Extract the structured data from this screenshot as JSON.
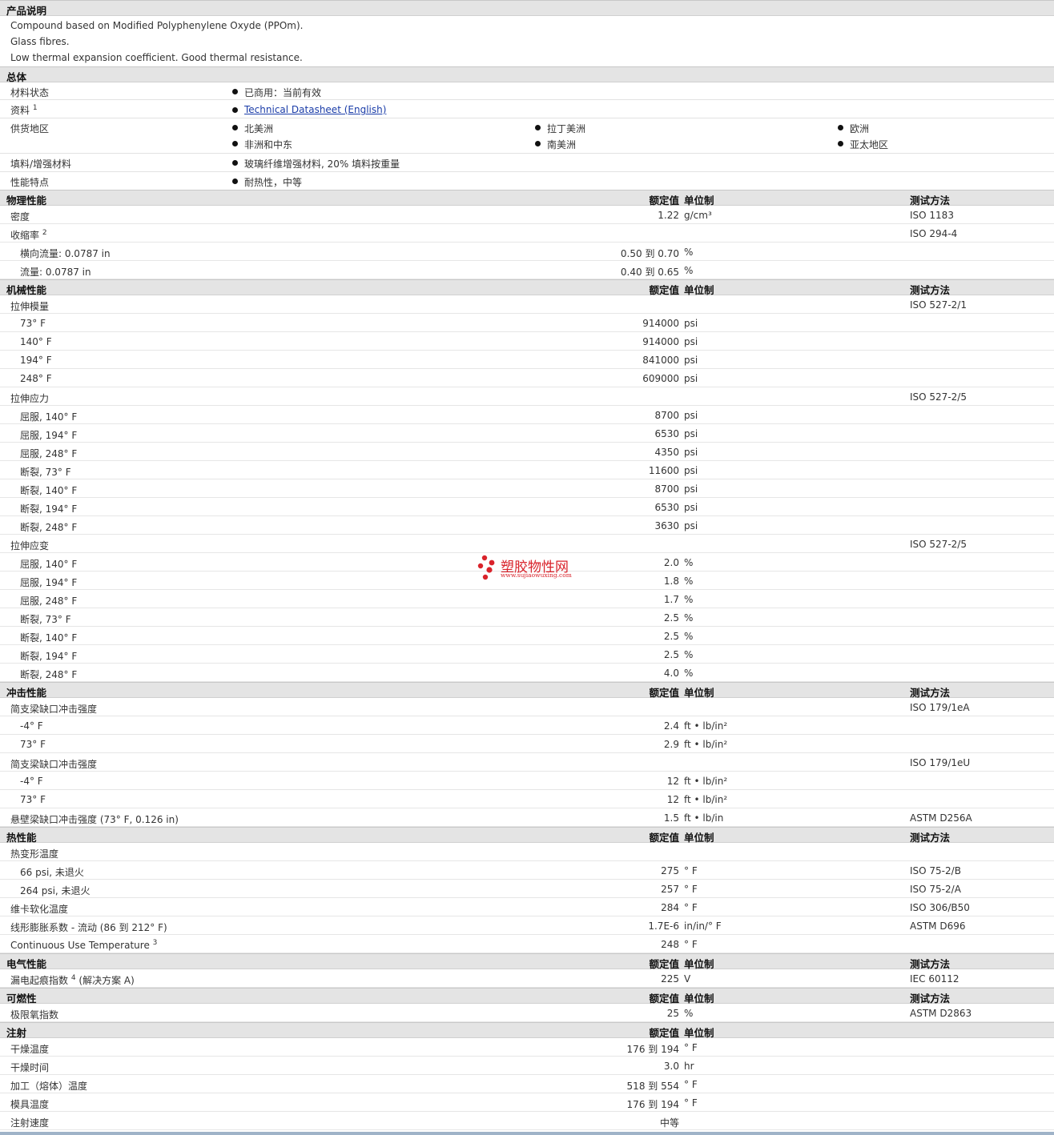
{
  "sections": {
    "description": {
      "title": "产品说明",
      "lines": [
        "Compound based on Modified Polyphenylene Oxyde (PPOm).",
        "Glass fibres.",
        "Low thermal expansion coefficient. Good thermal resistance."
      ]
    },
    "general": {
      "title": "总体",
      "status_label": "材料状态",
      "status_value": "已商用：当前有效",
      "docs_label": "资料",
      "docs_sup": "1",
      "docs_link": "Technical Datasheet (English)",
      "regions_label": "供货地区",
      "regions": [
        "北美洲",
        "拉丁美洲",
        "欧洲",
        "非洲和中东",
        "南美洲",
        "亚太地区"
      ],
      "filler_label": "填料/增强材料",
      "filler_value": "玻璃纤维增强材料, 20% 填料按重量",
      "features_label": "性能特点",
      "features_value": "耐热性，中等"
    },
    "physical": {
      "title": "物理性能",
      "h_val": "额定值",
      "h_unit": "单位制",
      "h_method": "测试方法"
    },
    "mechanical": {
      "title": "机械性能",
      "h_val": "额定值",
      "h_unit": "单位制",
      "h_method": "测试方法"
    },
    "impact": {
      "title": "冲击性能",
      "h_val": "额定值",
      "h_unit": "单位制",
      "h_method": "测试方法"
    },
    "thermal": {
      "title": "热性能",
      "h_val": "额定值",
      "h_unit": "单位制",
      "h_method": "测试方法"
    },
    "electrical": {
      "title": "电气性能",
      "h_val": "额定值",
      "h_unit": "单位制",
      "h_method": "测试方法"
    },
    "flammability": {
      "title": "可燃性",
      "h_val": "额定值",
      "h_unit": "单位制",
      "h_method": "测试方法"
    },
    "injection": {
      "title": "注射",
      "h_val": "额定值",
      "h_unit": "单位制"
    }
  },
  "rows": {
    "physical": [
      {
        "label": "密度",
        "value": "1.22",
        "unit": "g/cm³",
        "method": "ISO 1183"
      },
      {
        "label": "收缩率",
        "sup": "2",
        "value": "",
        "unit": "",
        "method": "ISO 294-4"
      },
      {
        "label": "横向流量: 0.0787 in",
        "value": "0.50 到  0.70",
        "unit": "%",
        "method": ""
      },
      {
        "label": "流量: 0.0787 in",
        "value": "0.40 到  0.65",
        "unit": "%",
        "method": ""
      }
    ],
    "mechanical": [
      {
        "label": "拉伸模量",
        "value": "",
        "unit": "",
        "method": "ISO 527-2/1"
      },
      {
        "label": "73°  F",
        "value": "914000",
        "unit": "psi",
        "method": ""
      },
      {
        "label": "140°  F",
        "value": "914000",
        "unit": "psi",
        "method": ""
      },
      {
        "label": "194°  F",
        "value": "841000",
        "unit": "psi",
        "method": ""
      },
      {
        "label": "248°  F",
        "value": "609000",
        "unit": "psi",
        "method": ""
      },
      {
        "label": "拉伸应力",
        "value": "",
        "unit": "",
        "method": "ISO 527-2/5"
      },
      {
        "label": "屈服, 140°  F",
        "value": "8700",
        "unit": "psi",
        "method": ""
      },
      {
        "label": "屈服, 194°  F",
        "value": "6530",
        "unit": "psi",
        "method": ""
      },
      {
        "label": "屈服, 248°  F",
        "value": "4350",
        "unit": "psi",
        "method": ""
      },
      {
        "label": "断裂, 73°  F",
        "value": "11600",
        "unit": "psi",
        "method": ""
      },
      {
        "label": "断裂, 140°  F",
        "value": "8700",
        "unit": "psi",
        "method": ""
      },
      {
        "label": "断裂, 194°  F",
        "value": "6530",
        "unit": "psi",
        "method": ""
      },
      {
        "label": "断裂, 248°  F",
        "value": "3630",
        "unit": "psi",
        "method": ""
      },
      {
        "label": "拉伸应变",
        "value": "",
        "unit": "",
        "method": "ISO 527-2/5"
      },
      {
        "label": "屈服, 140°  F",
        "value": "2.0",
        "unit": "%",
        "method": ""
      },
      {
        "label": "屈服, 194°  F",
        "value": "1.8",
        "unit": "%",
        "method": ""
      },
      {
        "label": "屈服, 248°  F",
        "value": "1.7",
        "unit": "%",
        "method": ""
      },
      {
        "label": "断裂, 73°  F",
        "value": "2.5",
        "unit": "%",
        "method": ""
      },
      {
        "label": "断裂, 140°  F",
        "value": "2.5",
        "unit": "%",
        "method": ""
      },
      {
        "label": "断裂, 194°  F",
        "value": "2.5",
        "unit": "%",
        "method": ""
      },
      {
        "label": "断裂, 248°  F",
        "value": "4.0",
        "unit": "%",
        "method": ""
      }
    ],
    "impact": [
      {
        "label": "简支梁缺口冲击强度",
        "value": "",
        "unit": "",
        "method": "ISO 179/1eA"
      },
      {
        "label": "-4°  F",
        "value": "2.4",
        "unit": "ft • lb/in²",
        "method": ""
      },
      {
        "label": "73°  F",
        "value": "2.9",
        "unit": "ft • lb/in²",
        "method": ""
      },
      {
        "label": "简支梁缺口冲击强度",
        "value": "",
        "unit": "",
        "method": "ISO 179/1eU"
      },
      {
        "label": "-4°  F",
        "value": "12",
        "unit": "ft • lb/in²",
        "method": ""
      },
      {
        "label": "73°  F",
        "value": "12",
        "unit": "ft • lb/in²",
        "method": ""
      },
      {
        "label": "悬壁梁缺口冲击强度  (73°  F, 0.126 in)",
        "value": "1.5",
        "unit": "ft • lb/in",
        "method": "ASTM D256A"
      }
    ],
    "thermal": [
      {
        "label": "热变形温度",
        "value": "",
        "unit": "",
        "method": ""
      },
      {
        "label": "66 psi, 未退火",
        "value": "275",
        "unit": "°  F",
        "method": "ISO 75-2/B"
      },
      {
        "label": "264 psi, 未退火",
        "value": "257",
        "unit": "°  F",
        "method": "ISO 75-2/A"
      },
      {
        "label": "维卡软化温度",
        "value": "284",
        "unit": "°  F",
        "method": "ISO 306/B50"
      },
      {
        "label": "线形膨胀系数  - 流动  (86 到  212°  F)",
        "value": "1.7E-6",
        "unit": "in/in/°  F",
        "method": "ASTM D696"
      },
      {
        "label": "Continuous Use Temperature",
        "sup": "3",
        "value": "248",
        "unit": "°  F",
        "method": ""
      }
    ],
    "electrical": [
      {
        "label": "漏电起痕指数",
        "sup": "4",
        "label_suffix": " (解决方案  A)",
        "value": "225",
        "unit": "V",
        "method": "IEC 60112"
      }
    ],
    "flammability": [
      {
        "label": "极限氧指数",
        "value": "25",
        "unit": "%",
        "method": "ASTM D2863"
      }
    ],
    "injection": [
      {
        "label": "干燥温度",
        "value": "176 到  194",
        "unit": "°  F",
        "method": ""
      },
      {
        "label": "干燥时间",
        "value": "3.0",
        "unit": "hr",
        "method": ""
      },
      {
        "label": "加工（熔体）温度",
        "value": "518 到  554",
        "unit": "°  F",
        "method": ""
      },
      {
        "label": "模具温度",
        "value": "176 到  194",
        "unit": "°  F",
        "method": ""
      },
      {
        "label": "注射速度",
        "value": "中等",
        "unit": "",
        "method": ""
      }
    ]
  },
  "watermark": {
    "name": "塑胶物性网",
    "url": "www.sujiaowuxing.com"
  },
  "colors": {
    "header_bg": "#e4e4e4",
    "link": "#1a3ca8",
    "watermark": "#d9232b"
  }
}
